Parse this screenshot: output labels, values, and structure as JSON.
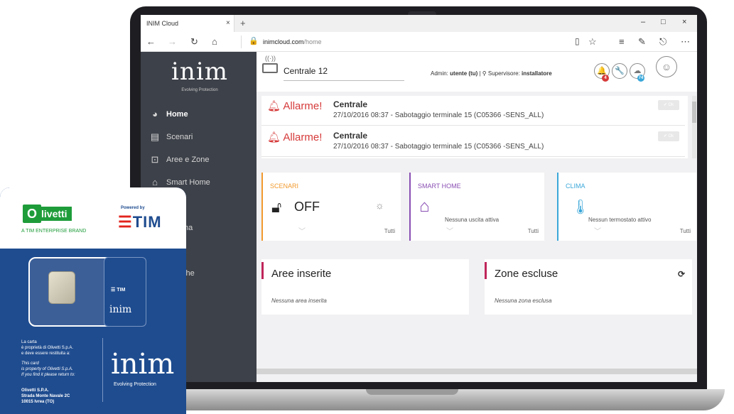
{
  "browser": {
    "tab_title": "INIM Cloud",
    "tab_close": "×",
    "new_tab": "+",
    "url_host": "inimcloud.com",
    "url_path": "/home",
    "win_min": "–",
    "win_max": "□",
    "win_close": "×"
  },
  "app": {
    "logo_text": "inim",
    "tagline": "Evolving Protection",
    "sidebar": [
      {
        "label": "Home",
        "icon": "dashboard-icon",
        "active": true
      },
      {
        "label": "Scenari",
        "icon": "clapper-icon",
        "active": false
      },
      {
        "label": "Aree e Zone",
        "icon": "lock-icon",
        "active": false
      },
      {
        "label": "Smart Home",
        "icon": "house-wifi-icon",
        "active": false
      },
      {
        "label": "ma",
        "icon": "",
        "active": false
      },
      {
        "label": "i",
        "icon": "",
        "active": false
      },
      {
        "label": "che",
        "icon": "",
        "active": false
      }
    ],
    "central_name": "Centrale 12",
    "admin_label": "Admin:",
    "admin_value": "utente (tu)",
    "supervisor_label": "Supervisore:",
    "supervisor_value": "installatore",
    "bell_badge": "4",
    "cloud_badge": "74"
  },
  "alarms": [
    {
      "label": "Allarme!",
      "title": "Centrale",
      "desc": "27/10/2016 08:37 - Sabotaggio terminale 15 (C05366 -SENS_ALL)",
      "ok": "✔ Ok"
    },
    {
      "label": "Allarme!",
      "title": "Centrale",
      "desc": "27/10/2016 08:37 - Sabotaggio terminale 15 (C05366 -SENS_ALL)",
      "ok": "✔ Ok"
    }
  ],
  "cards": {
    "scenari": {
      "title": "SCENARI",
      "state": "OFF",
      "foot": "Tutti"
    },
    "smart_home": {
      "title": "SMART HOME",
      "text": "Nessuna uscita attiva",
      "foot": "Tutti"
    },
    "clima": {
      "title": "CLIMA",
      "text": "Nessun termostato attivo",
      "foot": "Tutti"
    }
  },
  "zones": {
    "aree_title": "Aree inserite",
    "aree_empty": "Nessuna area inserita",
    "escluse_title": "Zone escluse",
    "escluse_empty": "Nessuna zona esclusa"
  },
  "sim": {
    "brand": "livetti",
    "brand_initial": "O",
    "brand_sub": "A TIM ENTERPRISE BRAND",
    "powered_by": "Powered by",
    "tim": "TIM",
    "tim_mark": "☰",
    "mini_brand": "inim",
    "mini_tim": "☰ TIM",
    "text_it": "La carta\nè proprietà di Olivetti S.p.A.\ne deve essere restituita a:",
    "text_en": "This card\nis property of Olivetti S.p.A.\nIf you find it please return to:",
    "address": "Olivetti S.P.A.\nStrada Monte Navale 2C\n10015 Ivrea (TO)",
    "logo_text": "inim",
    "tagline": "Evolving Protection"
  },
  "colors": {
    "sidebar": "#3d4149",
    "alarm": "#d63a3a",
    "scenari": "#f29a2e",
    "smart_home": "#8a4fb3",
    "clima": "#3aa7d9",
    "zone_accent": "#c0265a",
    "sim_blue": "#1f4c8f",
    "olivetti_green": "#1e9c3a",
    "tim_red": "#e2241e"
  }
}
